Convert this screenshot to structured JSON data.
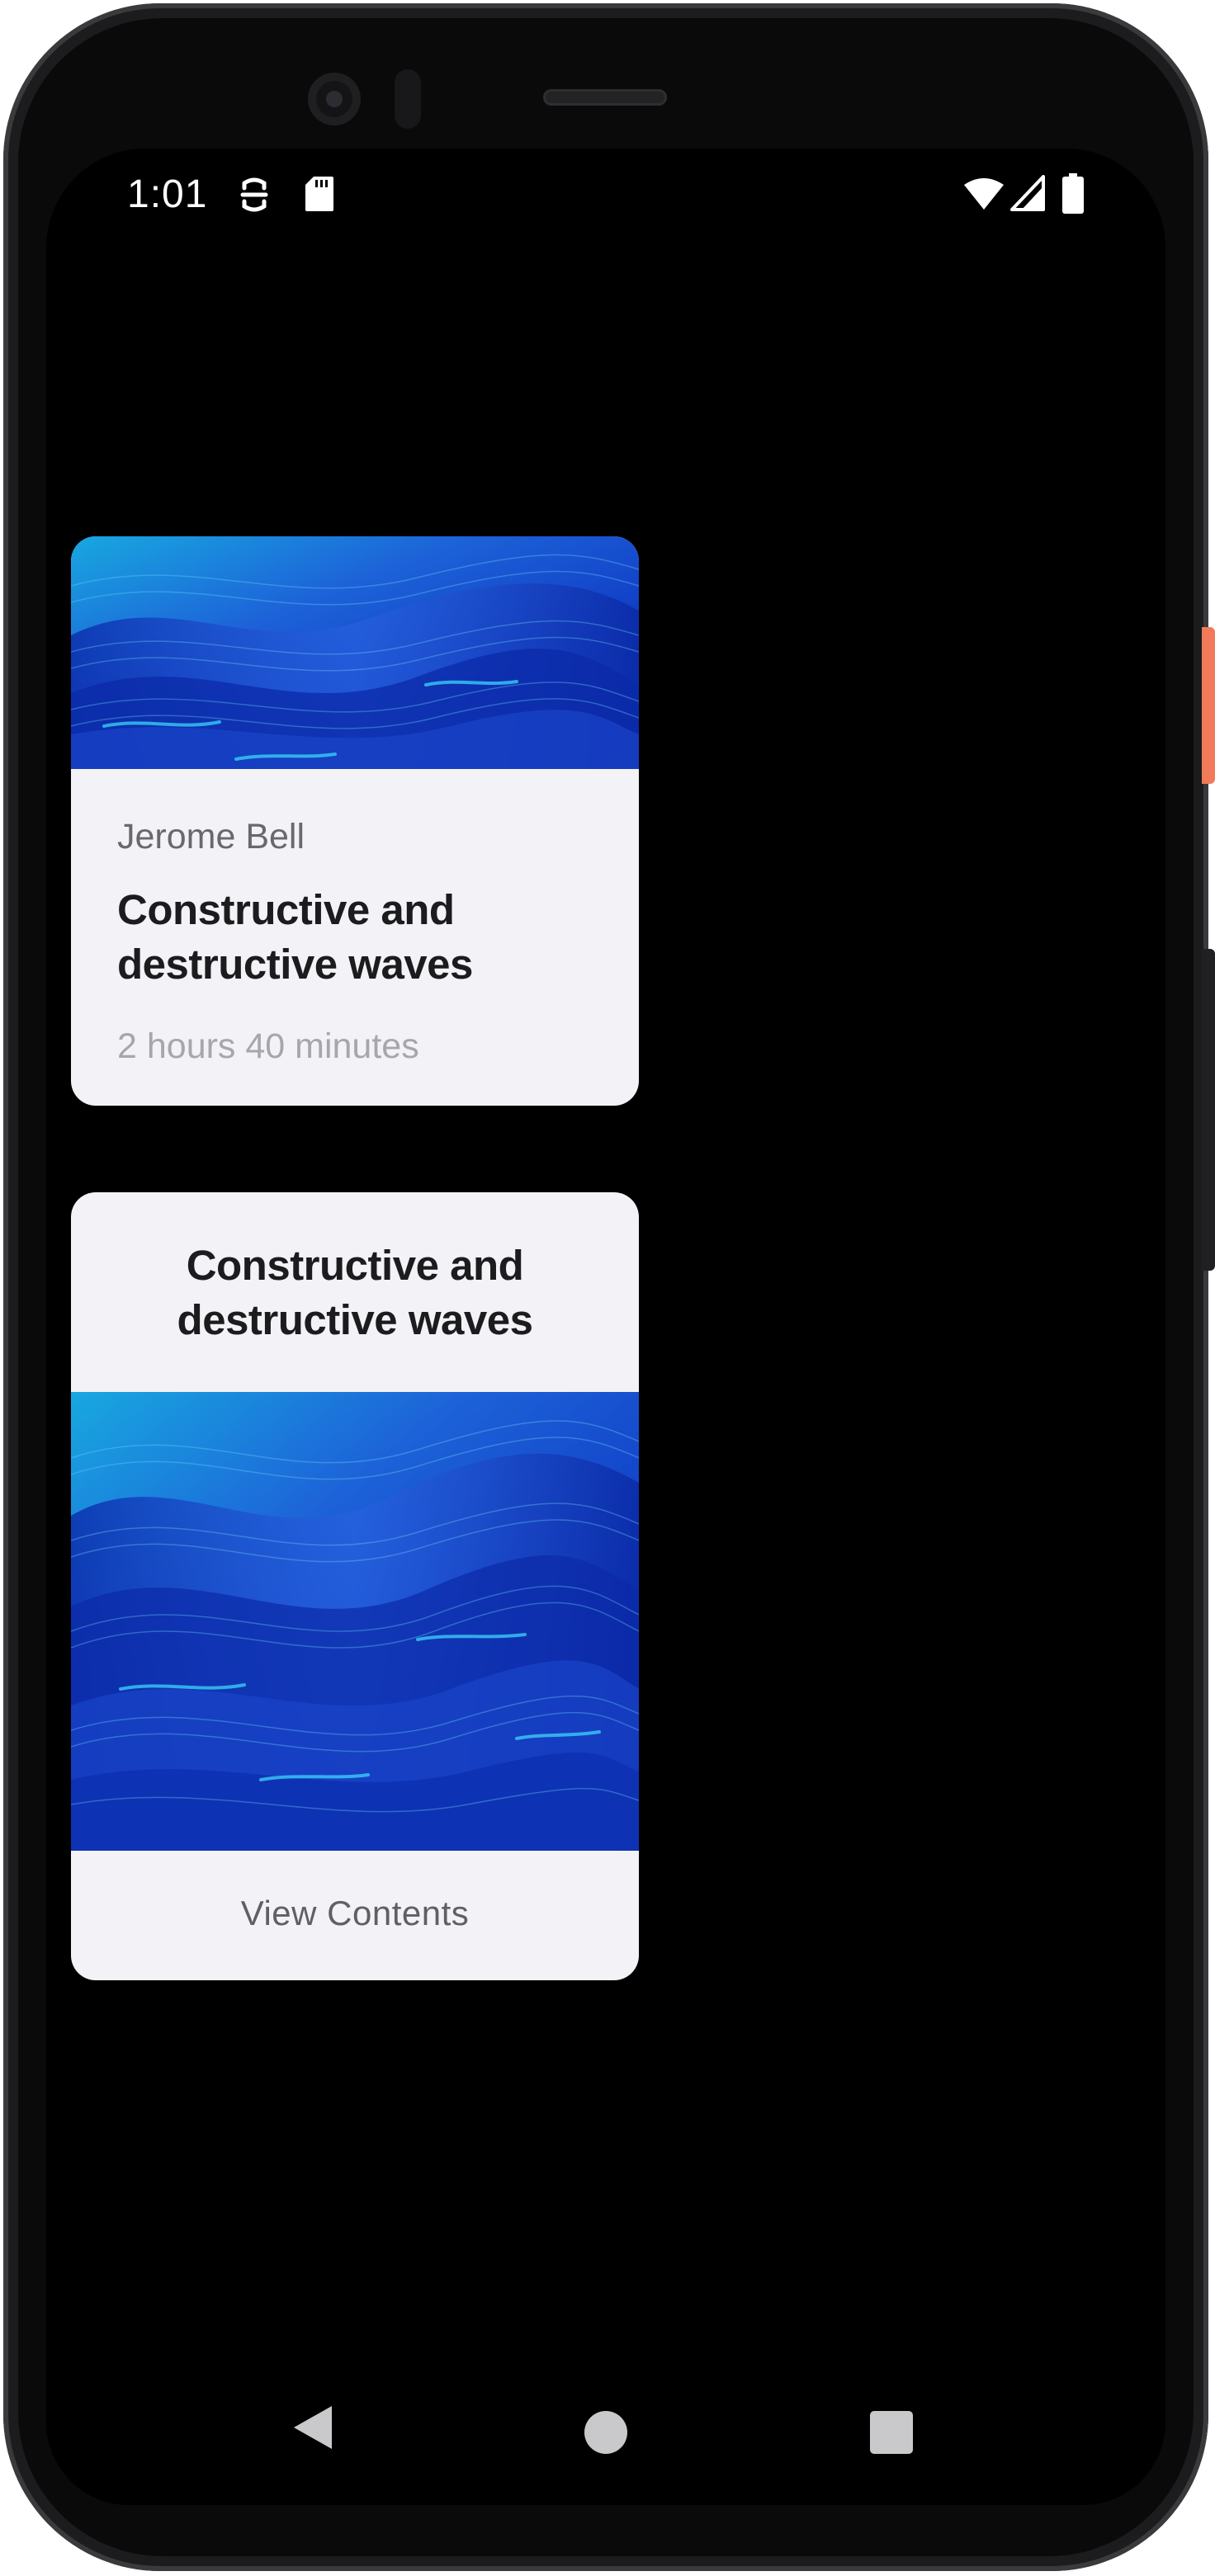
{
  "status_bar": {
    "time": "1:01",
    "icons": [
      "data-saver-icon",
      "sd-card-icon",
      "wifi-icon",
      "cell-signal-icon",
      "battery-icon"
    ]
  },
  "card_course": {
    "author": "Jerome Bell",
    "title": "Constructive and destructive waves",
    "duration": "2 hours 40 minutes"
  },
  "card_contents": {
    "title": "Constructive and destructive waves",
    "action_label": "View Contents"
  },
  "navigation_bar": {
    "icons": [
      "back-icon",
      "home-icon",
      "recents-icon"
    ]
  },
  "colors": {
    "card_background": "#f3f2f7",
    "screen_background": "#000000",
    "wave_deep": "#0a2fb8",
    "wave_light": "#1fb4e6",
    "frame_accent": "#f07a5a"
  }
}
